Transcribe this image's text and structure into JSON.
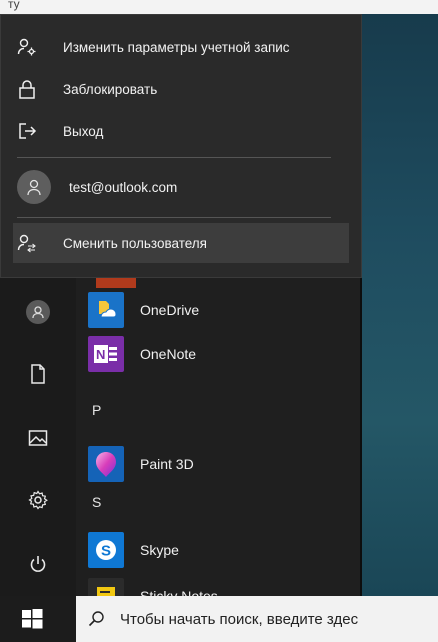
{
  "top_fragment": "ту",
  "flyout": {
    "items": [
      {
        "label": "Изменить параметры учетной запис",
        "icon": "user-gear-icon"
      },
      {
        "label": "Заблокировать",
        "icon": "lock-icon"
      },
      {
        "label": "Выход",
        "icon": "sign-out-icon"
      }
    ],
    "account_email": "test@outlook.com",
    "switch_user_label": "Сменить пользователя"
  },
  "apps": {
    "onedrive": "OneDrive",
    "onenote": "OneNote",
    "section_p": "P",
    "paint3d": "Paint 3D",
    "section_s": "S",
    "skype": "Skype",
    "sticky": "Sticky Notes"
  },
  "taskbar": {
    "search_placeholder": "Чтобы начать поиск, введите здес"
  },
  "colors": {
    "onedrive": "#1a73c8",
    "onenote": "#7a2ea8",
    "skype": "#0f78d4",
    "sticky": "#f2c811"
  }
}
